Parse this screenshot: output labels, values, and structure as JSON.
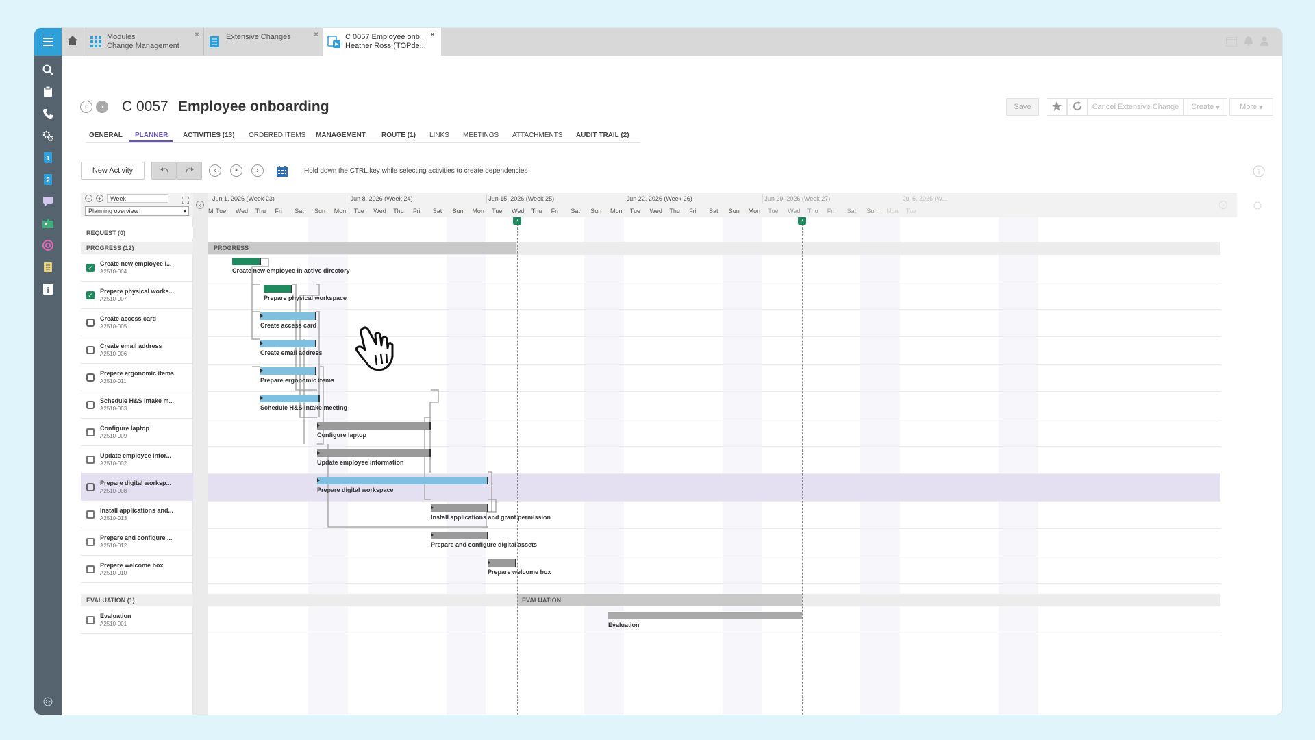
{
  "tabs": [
    {
      "title": "Modules",
      "subtitle": "Change Management",
      "icon": "modules-grid-icon"
    },
    {
      "title": "Extensive Changes",
      "subtitle": "",
      "icon": "list-icon"
    },
    {
      "title": "C 0057 Employee onb...",
      "subtitle": "Heather Ross (TOPde...",
      "icon": "change-doc-icon"
    }
  ],
  "record": {
    "id": "C 0057",
    "name": "Employee onboarding"
  },
  "toolbar": {
    "save": "Save",
    "cancel": "Cancel Extensive Change",
    "create": "Create",
    "more": "More"
  },
  "subtabs": [
    "GENERAL",
    "PLANNER",
    "ACTIVITIES (13)",
    "ORDERED ITEMS",
    "MANAGEMENT",
    "ROUTE (1)",
    "LINKS",
    "MEETINGS",
    "ATTACHMENTS",
    "AUDIT TRAIL (2)"
  ],
  "planner": {
    "new_activity": "New Activity",
    "hint": "Hold down the CTRL key while selecting activities to create dependencies",
    "zoom": "Week",
    "view": "Planning overview",
    "weeks": [
      "Jun 1, 2026 (Week 23)",
      "Jun 8, 2026 (Week 24)",
      "Jun 15, 2026 (Week 25)",
      "Jun 22, 2026 (Week 26)",
      "Jun 29, 2026 (Week 27)",
      "Jul 6, 2026 (W..."
    ],
    "days": [
      "M",
      "Tue",
      "Wed",
      "Thu",
      "Fri",
      "Sat",
      "Sun",
      "Mon",
      "Tue",
      "Wed",
      "Thu",
      "Fri",
      "Sat",
      "Sun",
      "Mon",
      "Tue",
      "Wed",
      "Thu",
      "Fri",
      "Sat",
      "Sun",
      "Mon",
      "Tue",
      "Wed",
      "Thu",
      "Fri",
      "Sat",
      "Sun",
      "Mon",
      "Tue",
      "Wed",
      "Thu",
      "Fri",
      "Sat",
      "Sun",
      "Mon",
      "Tue"
    ]
  },
  "groups": {
    "request": "REQUEST   (0)",
    "progress": "PROGRESS   (12)",
    "evaluation": "EVALUATION   (1)",
    "progress_band": "PROGRESS",
    "evaluation_band": "EVALUATION"
  },
  "activities": [
    {
      "name": "Create new employee i...",
      "code": "A2510-004",
      "label": "Create new employee in active directory",
      "status": "done"
    },
    {
      "name": "Prepare physical works...",
      "code": "A2510-007",
      "label": "Prepare physical workspace",
      "status": "done"
    },
    {
      "name": "Create access card",
      "code": "A2510-005",
      "label": "Create access card",
      "status": "active"
    },
    {
      "name": "Create email address",
      "code": "A2510-006",
      "label": "Create email address",
      "status": "active"
    },
    {
      "name": "Prepare ergonomic items",
      "code": "A2510-011",
      "label": "Prepare ergonomic items",
      "status": "active"
    },
    {
      "name": "Schedule H&S intake m...",
      "code": "A2510-003",
      "label": "Schedule H&S intake meeting",
      "status": "active"
    },
    {
      "name": "Configure laptop",
      "code": "A2510-009",
      "label": "Configure laptop",
      "status": "planned"
    },
    {
      "name": "Update employee infor...",
      "code": "A2510-002",
      "label": "Update employee information",
      "status": "planned"
    },
    {
      "name": "Prepare digital worksp...",
      "code": "A2510-008",
      "label": "Prepare digital workspace",
      "status": "active"
    },
    {
      "name": "Install applications and...",
      "code": "A2510-013",
      "label": "Install applications and grant permission",
      "status": "planned"
    },
    {
      "name": "Prepare and configure ...",
      "code": "A2510-012",
      "label": "Prepare and configure digital assets",
      "status": "planned"
    },
    {
      "name": "Prepare welcome box",
      "code": "A2510-010",
      "label": "Prepare welcome box",
      "status": "planned"
    }
  ],
  "evaluation_activity": {
    "name": "Evaluation",
    "code": "A2510-001",
    "label": "Evaluation"
  },
  "colors": {
    "done": "#1f8a5e",
    "active": "#7fbfe0",
    "planned": "#9a9a9a",
    "accent": "#6a52c2",
    "nav": "#54636e",
    "brand": "#2e9fd8"
  }
}
